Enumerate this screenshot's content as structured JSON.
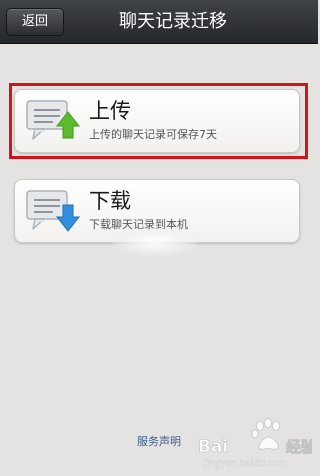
{
  "navbar": {
    "back_label": "返回",
    "title": "聊天记录迁移"
  },
  "options": [
    {
      "title": "上传",
      "subtitle": "上传的聊天记录可保存7天",
      "icon": "chat-upload-icon",
      "arrow_color": "#5cbb2c",
      "highlighted": true
    },
    {
      "title": "下载",
      "subtitle": "下载聊天记录到本机",
      "icon": "chat-download-icon",
      "arrow_color": "#2f8fdc",
      "highlighted": false
    }
  ],
  "footer": {
    "link_label": "服务声明"
  },
  "watermark": {
    "brand": "Baidu经验",
    "url": "jingyan.baidu.com"
  },
  "colors": {
    "highlight": "#d0141a",
    "navbar": "#2e3034",
    "background": "#e4e3e1",
    "link": "#3d5f8e"
  }
}
